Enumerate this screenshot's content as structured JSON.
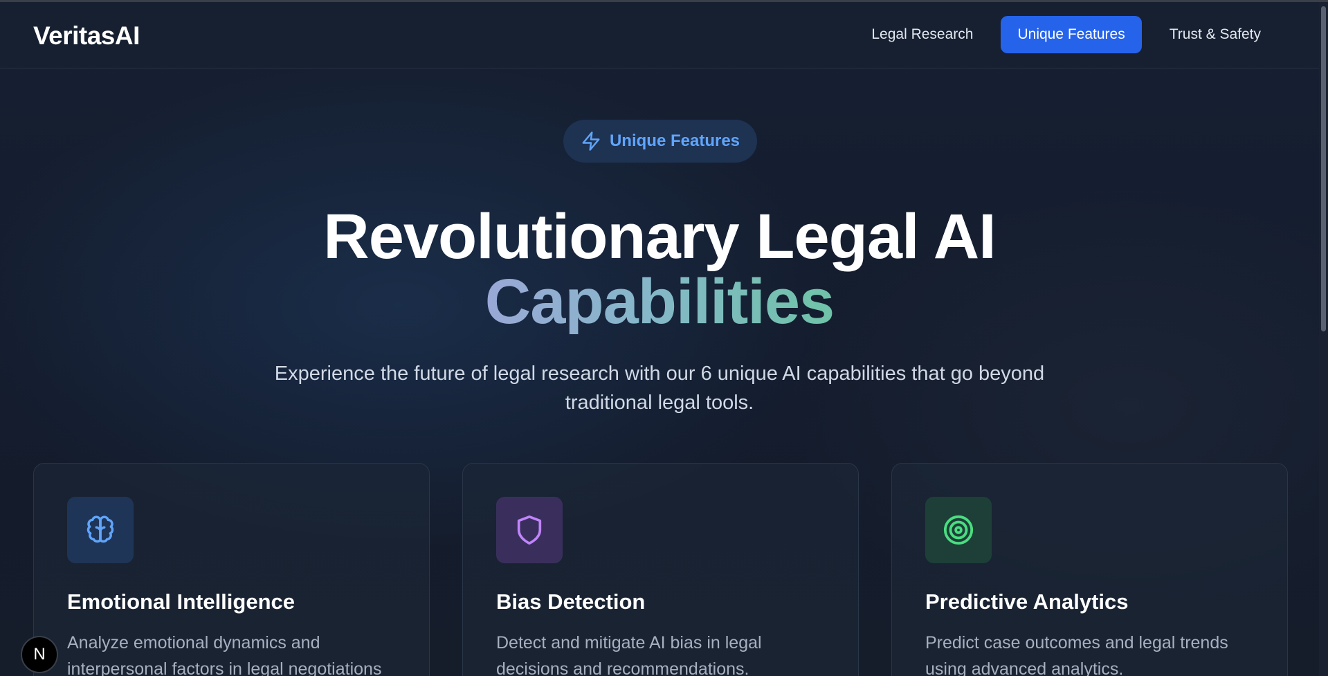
{
  "header": {
    "logo": "VeritasAI",
    "nav": [
      {
        "label": "Legal Research",
        "active": false
      },
      {
        "label": "Unique Features",
        "active": true
      },
      {
        "label": "Trust & Safety",
        "active": false
      }
    ]
  },
  "hero": {
    "badge": {
      "label": "Unique Features",
      "icon": "lightning-bolt-icon"
    },
    "title_line1": "Revolutionary Legal AI",
    "title_line2": "Capabilities",
    "subtitle": "Experience the future of legal research with our 6 unique AI capabilities that go beyond traditional legal tools."
  },
  "cards": [
    {
      "icon": "brain-icon",
      "icon_color": "#60a5fa",
      "icon_bg": "#1f3557",
      "title": "Emotional Intelligence",
      "description": "Analyze emotional dynamics and interpersonal factors in legal negotiations"
    },
    {
      "icon": "shield-icon",
      "icon_color": "#c084fc",
      "icon_bg": "#3a2f5c",
      "title": "Bias Detection",
      "description": "Detect and mitigate AI bias in legal decisions and recommendations."
    },
    {
      "icon": "target-icon",
      "icon_color": "#4ade80",
      "icon_bg": "#1d3f38",
      "title": "Predictive Analytics",
      "description": "Predict case outcomes and legal trends using advanced analytics."
    }
  ],
  "floating_button": {
    "label": "N"
  },
  "colors": {
    "accent": "#2563eb",
    "badge_text": "#60a5fa",
    "background": "#141b2b"
  }
}
